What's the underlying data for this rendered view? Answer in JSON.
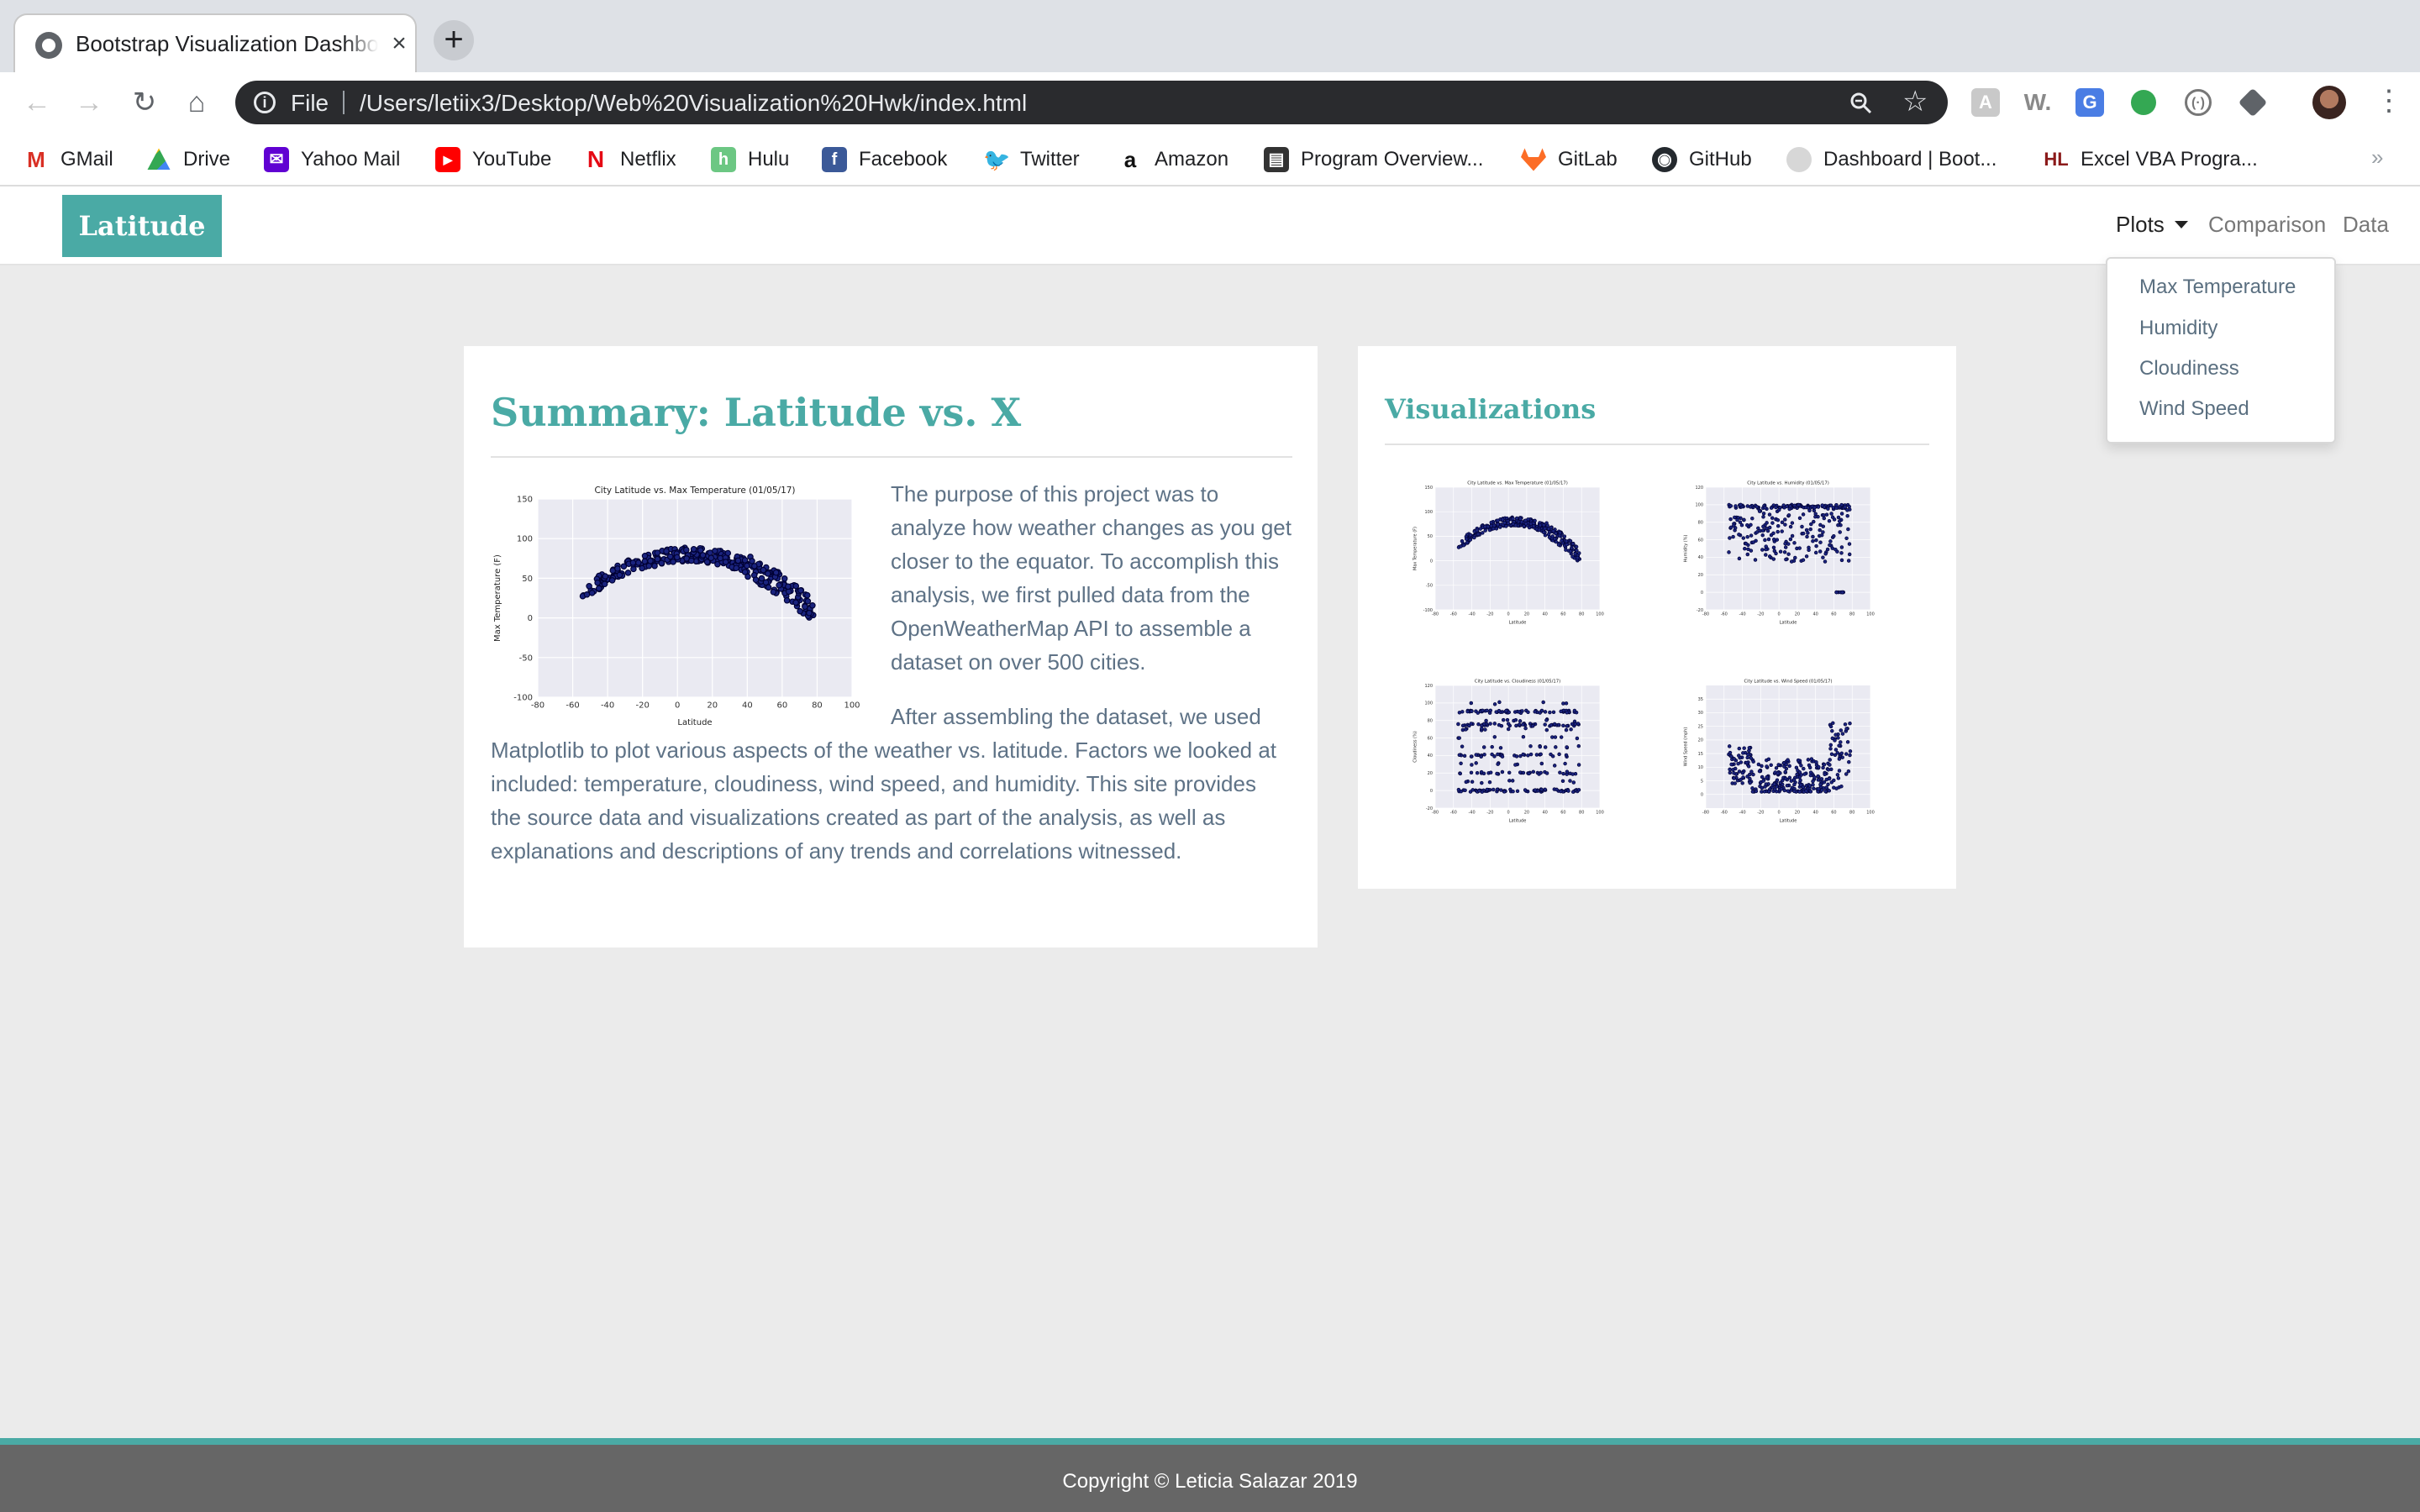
{
  "browser": {
    "tab_title": "Bootstrap Visualization Dashboard",
    "new_tab_symbol": "+",
    "address_scheme": "File",
    "address_url": "/Users/letiix3/Desktop/Web%20Visualization%20Hwk/index.html",
    "extensions": [
      "extension-a-icon",
      "w-extension-icon",
      "google-translate-icon",
      "green-dot-extension-icon",
      "bracket-extension-icon",
      "layers-extension-icon"
    ],
    "bookmarks": [
      {
        "label": "GMail",
        "icon": "gmail-icon",
        "color": "#d93025"
      },
      {
        "label": "Drive",
        "icon": "drive-icon",
        "color": "#1fa463"
      },
      {
        "label": "Yahoo Mail",
        "icon": "yahoo-mail-icon",
        "color": "#6001d2"
      },
      {
        "label": "YouTube",
        "icon": "youtube-icon",
        "color": "#ff0000"
      },
      {
        "label": "Netflix",
        "icon": "netflix-icon",
        "color": "#e50914"
      },
      {
        "label": "Hulu",
        "icon": "hulu-icon",
        "color": "#6cc783"
      },
      {
        "label": "Facebook",
        "icon": "facebook-icon",
        "color": "#3b5998"
      },
      {
        "label": "Twitter",
        "icon": "twitter-icon",
        "color": "#1da1f2"
      },
      {
        "label": "Amazon",
        "icon": "amazon-icon",
        "color": "#ffffff"
      },
      {
        "label": "Program Overview...",
        "icon": "book-icon",
        "color": "#333333"
      },
      {
        "label": "GitLab",
        "icon": "gitlab-icon",
        "color": "#fc6d26"
      },
      {
        "label": "GitHub",
        "icon": "github-icon",
        "color": "#24292e"
      },
      {
        "label": "Dashboard | Boot...",
        "icon": "globe-icon",
        "color": "#d7d7d7"
      },
      {
        "label": "Excel VBA Progra...",
        "icon": "hl-icon",
        "color": "#ffffff"
      }
    ],
    "bookmarks_overflow": "»"
  },
  "site": {
    "brand": "Latitude",
    "nav": {
      "plots": "Plots",
      "comparison": "Comparison",
      "data": "Data"
    },
    "dropdown": [
      "Max Temperature",
      "Humidity",
      "Cloudiness",
      "Wind Speed"
    ]
  },
  "summary": {
    "title": "Summary: Latitude vs. X",
    "paragraph_1": "The purpose of this project was to analyze how weather changes as you get closer to the equator. To accomplish this analysis, we first pulled data from the OpenWeatherMap API to assemble a dataset on over 500 cities.",
    "paragraph_2": "After assembling the dataset, we used Matplotlib to plot various aspects of the weather vs. latitude. Factors we looked at included: temperature, cloudiness, wind speed, and humidity. This site provides the source data and visualizations created as part of the analysis, as well as explanations and descriptions of any trends and correlations witnessed."
  },
  "visualizations": {
    "title": "Visualizations"
  },
  "footer": {
    "text": "Copyright © Leticia Salazar 2019"
  },
  "colors": {
    "accent": "#4aaaa5",
    "point": "#1a237e",
    "plot_bg": "#eaeaf2"
  },
  "chart_data": [
    {
      "type": "scatter",
      "title": "City Latitude vs. Max Temperature (01/05/17)",
      "xlabel": "Latitude",
      "ylabel": "Max Temperature (F)",
      "xlim": [
        -80,
        100
      ],
      "ylim": [
        -100,
        150
      ],
      "xticks": [
        -80,
        -60,
        -40,
        -20,
        0,
        20,
        40,
        60,
        80,
        100
      ],
      "yticks": [
        -100,
        -50,
        0,
        50,
        100,
        150
      ],
      "trend": [
        [
          -55,
          40
        ],
        [
          -40,
          62
        ],
        [
          -20,
          75
        ],
        [
          0,
          80
        ],
        [
          15,
          76
        ],
        [
          30,
          60
        ],
        [
          45,
          35
        ],
        [
          60,
          15
        ],
        [
          70,
          -5
        ],
        [
          75,
          -30
        ]
      ]
    },
    {
      "type": "scatter",
      "title": "City Latitude vs. Humidity (01/05/17)",
      "xlabel": "Latitude",
      "ylabel": "Humidity (%)",
      "xlim": [
        -80,
        100
      ],
      "ylim": [
        -20,
        120
      ],
      "xticks": [
        -80,
        -60,
        -40,
        -20,
        0,
        20,
        40,
        60,
        80,
        100
      ],
      "yticks": [
        -20,
        0,
        20,
        40,
        60,
        80,
        100,
        120
      ]
    },
    {
      "type": "scatter",
      "title": "City Latitude vs. Cloudiness (01/05/17)",
      "xlabel": "Latitude",
      "ylabel": "Cloudiness (%)",
      "xlim": [
        -80,
        100
      ],
      "ylim": [
        -20,
        120
      ],
      "xticks": [
        -80,
        -60,
        -40,
        -20,
        0,
        20,
        40,
        60,
        80,
        100
      ],
      "yticks": [
        -20,
        0,
        20,
        40,
        60,
        80,
        100,
        120
      ]
    },
    {
      "type": "scatter",
      "title": "City Latitude vs. Wind Speed (01/05/17)",
      "xlabel": "Latitude",
      "ylabel": "Wind Speed (mph)",
      "xlim": [
        -80,
        100
      ],
      "ylim": [
        -5,
        40
      ],
      "xticks": [
        -80,
        -60,
        -40,
        -20,
        0,
        20,
        40,
        60,
        80,
        100
      ],
      "yticks": [
        0,
        5,
        10,
        15,
        20,
        25,
        30,
        35
      ]
    }
  ]
}
